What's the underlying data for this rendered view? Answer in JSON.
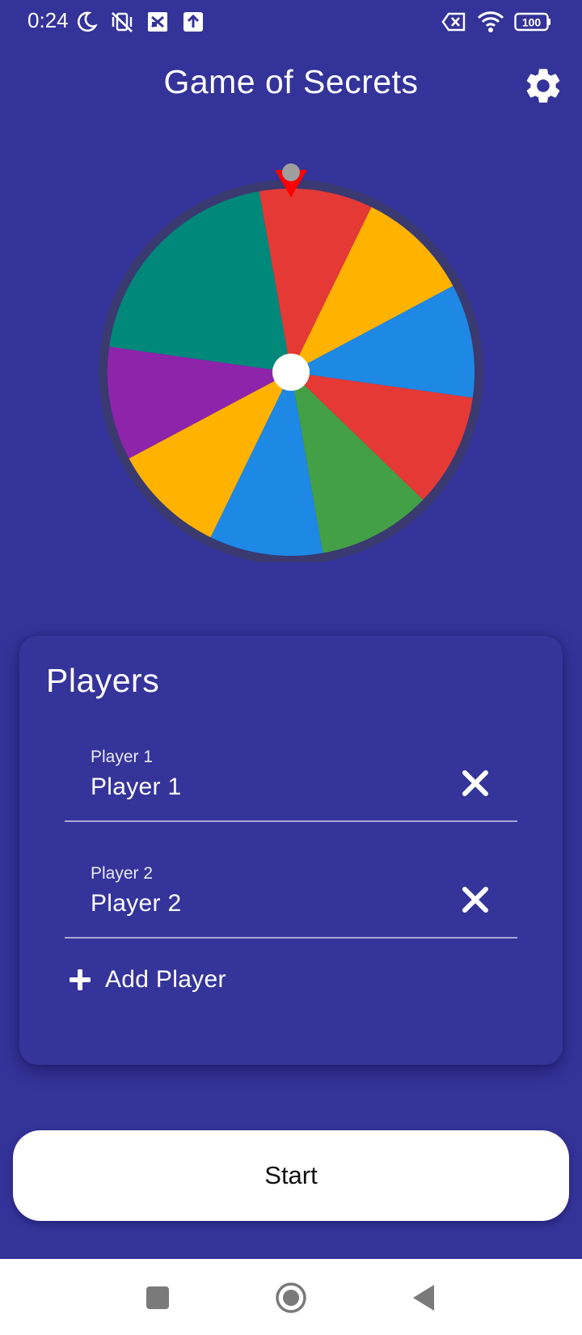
{
  "status_bar": {
    "time": "0:24",
    "battery": "100",
    "icons_left": [
      "moon-icon",
      "vibrate-off-icon",
      "screen-record-icon",
      "upload-icon"
    ],
    "icons_right": [
      "no-sim-icon",
      "wifi-icon",
      "battery-icon"
    ]
  },
  "header": {
    "title": "Game of Secrets",
    "settings_icon": "gear-icon"
  },
  "wheel": {
    "segment_count": 10,
    "rotation_offset_deg": -10,
    "colors": [
      "#E53935",
      "#FFB300",
      "#1E88E5",
      "#E53935",
      "#43A047",
      "#1E88E5",
      "#FFB300",
      "#8E24AA",
      "#00897B"
    ],
    "segment_colors_clockwise_from_top": [
      "#E53935",
      "#FFB300",
      "#1E88E5",
      "#E53935",
      "#43A047",
      "#1E88E5",
      "#FFB300",
      "#8E24AA",
      "#00897B",
      "#00897B"
    ],
    "rim_color": "#3A3970",
    "pointer_color": "#FF0000",
    "pointer_knob_color": "#9E9E9E",
    "hub_color": "#FFFFFF"
  },
  "players_card": {
    "title": "Players",
    "players": [
      {
        "label": "Player 1",
        "value": "Player 1"
      },
      {
        "label": "Player 2",
        "value": "Player 2"
      }
    ],
    "add_label": "Add Player"
  },
  "start_button": {
    "label": "Start"
  },
  "nav_bar": {
    "buttons": [
      "recents-square-icon",
      "home-circle-icon",
      "back-triangle-icon"
    ]
  },
  "colors": {
    "background": "#343399",
    "card": "#35349A",
    "text": "#FFFFFF",
    "button_bg": "#FFFFFF",
    "button_text": "#111111"
  }
}
